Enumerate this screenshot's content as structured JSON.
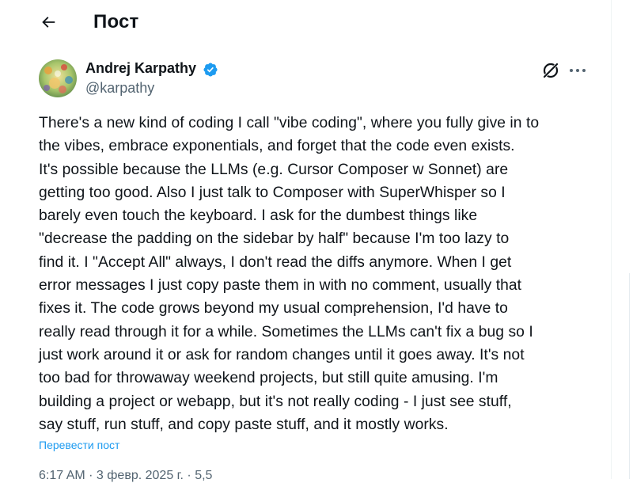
{
  "header": {
    "title": "Пост",
    "back_icon": "arrow-left-icon"
  },
  "post": {
    "author_name": "Andrej Karpathy",
    "handle": "@karpathy",
    "verified_color": "#1d9bf0",
    "lines": [
      "There's a new kind of coding I call \"vibe coding\", where you fully give in to",
      "the vibes, embrace exponentials, and forget that the code even exists.",
      "It's possible because the LLMs (e.g. Cursor Composer w Sonnet) are",
      "getting too good. Also I just talk to Composer with SuperWhisper so I",
      "barely even touch the keyboard. I ask for the dumbest things like",
      "\"decrease the padding on the sidebar by half\" because I'm too lazy to",
      "find it. I \"Accept All\" always, I don't read the diffs anymore. When I get",
      "error messages I just copy paste them in with no comment, usually that",
      "fixes it. The code grows beyond my usual comprehension, I'd have to",
      "really read through it for a while. Sometimes the LLMs can't fix a bug so I",
      "just work around it or ask for random changes until it goes away. It's not",
      "too bad for throwaway weekend projects, but still quite amusing. I'm",
      "building a project or webapp, but it's not really coding - I just see stuff,",
      "say stuff, run stuff, and copy paste stuff, and it mostly works."
    ],
    "translate_label": "Перевести пост",
    "timestamp": "6:17 AM · 3 февр. 2025 г. · 5,5"
  },
  "colors": {
    "text": "#0f1419",
    "secondary": "#536471",
    "accent": "#1d9bf0"
  },
  "icons": {
    "grok": "grok-icon",
    "more": "more-horizontal-icon",
    "verified": "verified-badge-icon"
  }
}
